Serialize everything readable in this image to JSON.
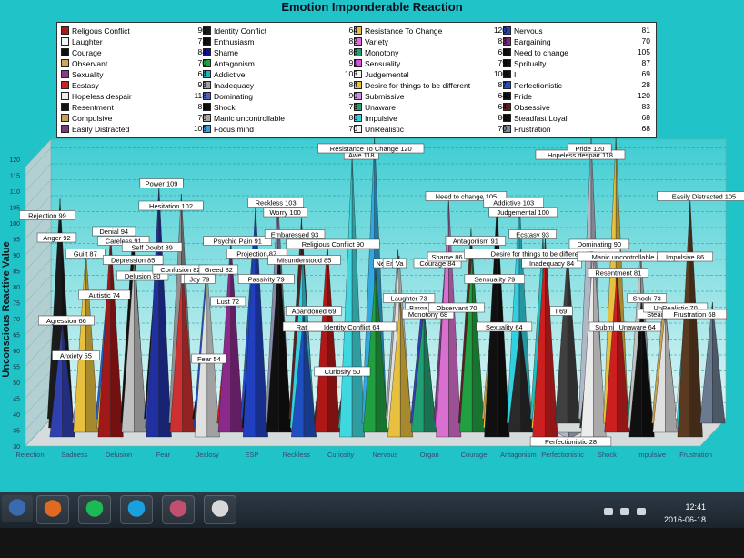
{
  "colors": {
    "screen": "#20c4c8",
    "plot_top": "#3ecdd2",
    "plot_bottom": "#e4f6f6",
    "floor": "#d6dcdc"
  },
  "chart_data": {
    "type": "area",
    "title": "Emotion Imponderable Reaction",
    "ylabel": "Unconscious Reactive Value",
    "ylim": [
      30,
      120
    ],
    "yticks": [
      30,
      35,
      40,
      45,
      50,
      55,
      60,
      65,
      70,
      75,
      80,
      85,
      90,
      95,
      100,
      105,
      110,
      115,
      120
    ],
    "grid": true,
    "x_tick_labels": [
      "Rejection",
      "Sadness",
      "Delusion",
      "Fear",
      "Jealosy",
      "ESP",
      "Reckless",
      "Curiosity",
      "Nervous",
      "Organ",
      "Courage",
      "Antagonism",
      "Perfectionistic",
      "Shock",
      "Impulsive",
      "Frustration"
    ],
    "legend": [
      {
        "name": "Religous Conflict",
        "value": 90,
        "color": "#b01818"
      },
      {
        "name": "Laughter",
        "value": 73,
        "color": "#f4f4f4"
      },
      {
        "name": "Courage",
        "value": 84,
        "color": "#101010"
      },
      {
        "name": "Observant",
        "value": 70,
        "color": "#ccaa55"
      },
      {
        "name": "Sexuality",
        "value": 64,
        "color": "#8a3a8a"
      },
      {
        "name": "Ecstasy",
        "value": 93,
        "color": "#d02020"
      },
      {
        "name": "Hopeless despair",
        "value": 118,
        "color": "#ececec"
      },
      {
        "name": "Resentment",
        "value": 81,
        "color": "#141414"
      },
      {
        "name": "Compulsive",
        "value": 70,
        "color": "#c8a050"
      },
      {
        "name": "Easily Distracted",
        "value": 105,
        "color": "#7a3a7a"
      },
      {
        "name": "Identity Conflict",
        "value": 64,
        "color": "#1a1a1a"
      },
      {
        "name": "Enthusiasm",
        "value": 82,
        "color": "#101010"
      },
      {
        "name": "Shame",
        "value": 86,
        "color": "#1010a0"
      },
      {
        "name": "Antagonism",
        "value": 91,
        "color": "#20a040"
      },
      {
        "name": "Addictive",
        "value": 103,
        "color": "#20b0c0"
      },
      {
        "name": "Inadequacy",
        "value": 84,
        "color": "#a0a0a0"
      },
      {
        "name": "Dominating",
        "value": 90,
        "color": "#5060c0"
      },
      {
        "name": "Shock",
        "value": 73,
        "color": "#101010"
      },
      {
        "name": "Manic uncontrollable",
        "value": 86,
        "color": "#a8a8a8"
      },
      {
        "name": "Focus mind",
        "value": 70,
        "color": "#30a0e0"
      },
      {
        "name": "Resistance To Change",
        "value": 120,
        "color": "#e8c040"
      },
      {
        "name": "Variety",
        "value": 83,
        "color": "#d870d0"
      },
      {
        "name": "Monotony",
        "value": 68,
        "color": "#20a070"
      },
      {
        "name": "Sensuality",
        "value": 79,
        "color": "#e050e0"
      },
      {
        "name": "Judgemental",
        "value": 100,
        "color": "#f4f4f4"
      },
      {
        "name": "Desire for things to be different",
        "value": 87,
        "color": "#e8c040"
      },
      {
        "name": "Submissive",
        "value": 64,
        "color": "#d090e0"
      },
      {
        "name": "Unaware",
        "value": 64,
        "color": "#20a070"
      },
      {
        "name": "Impulsive",
        "value": 86,
        "color": "#30d0e0"
      },
      {
        "name": "UnRealistic",
        "value": 70,
        "color": "#f4f4f4"
      },
      {
        "name": "Nervous",
        "value": 81,
        "color": "#2040c0"
      },
      {
        "name": "Bargaining",
        "value": 70,
        "color": "#7a2a7a"
      },
      {
        "name": "Need to change",
        "value": 105,
        "color": "#101010"
      },
      {
        "name": "Spritualty",
        "value": 87,
        "color": "#101010"
      },
      {
        "name": "I",
        "value": 69,
        "color": "#101010"
      },
      {
        "name": "Perfectionistic",
        "value": 28,
        "color": "#2050c0"
      },
      {
        "name": "Pride",
        "value": 120,
        "color": "#101010"
      },
      {
        "name": "Obsessive",
        "value": 83,
        "color": "#5a2020"
      },
      {
        "name": "Steadfast Loyal",
        "value": 68,
        "color": "#101010"
      },
      {
        "name": "Frustration",
        "value": 68,
        "color": "#7a8aa0"
      }
    ],
    "legend_column_values": [
      [
        90,
        73,
        84,
        70,
        64,
        93,
        118,
        81,
        70,
        105
      ],
      [
        64,
        82,
        86,
        91,
        103,
        84,
        90,
        73,
        86,
        70
      ],
      [
        120,
        83,
        68,
        79,
        100,
        87,
        64,
        64,
        86,
        70
      ],
      [
        81,
        70,
        105,
        87,
        69,
        28,
        120,
        83,
        68,
        68
      ]
    ],
    "series": [
      {
        "name": "Rejection",
        "value": 99,
        "color": "#1a1a1a"
      },
      {
        "name": "Anger",
        "value": 92,
        "color": "#1a1a1a"
      },
      {
        "name": "Agression",
        "value": 66,
        "color": "#3040b0"
      },
      {
        "name": "Anxiety",
        "value": 55,
        "color": "#b0b8c8"
      },
      {
        "name": "Guilt",
        "value": 87,
        "color": "#e8c040"
      },
      {
        "name": "Sadness",
        "value": 74,
        "color": "#2060d0"
      },
      {
        "name": "Autistic",
        "value": 74,
        "color": "#e8c040"
      },
      {
        "name": "Denial",
        "value": 94,
        "color": "#a01818"
      },
      {
        "name": "Careless",
        "value": 91,
        "color": "#101010"
      },
      {
        "name": "Depression",
        "value": 85,
        "color": "#c0c0c0"
      },
      {
        "name": "Delusion",
        "value": 80,
        "color": "#101010"
      },
      {
        "name": "Self Doubt",
        "value": 89,
        "color": "#3050c0"
      },
      {
        "name": "Power",
        "value": 109,
        "color": "#2030a0"
      },
      {
        "name": "Hesitation",
        "value": 102,
        "color": "#909090"
      },
      {
        "name": "Confusion",
        "value": 82,
        "color": "#cc3030"
      },
      {
        "name": "Fear",
        "value": 54,
        "color": "#101010"
      },
      {
        "name": "Jealosy",
        "value": 79,
        "color": "#2050c0"
      },
      {
        "name": "Greed",
        "value": 82,
        "color": "#e0e0e0"
      },
      {
        "name": "Lust",
        "value": 72,
        "color": "#cc2020"
      },
      {
        "name": "Psychic Pain",
        "value": 91,
        "color": "#8a2a8a"
      },
      {
        "name": "ESP",
        "value": 87,
        "color": "#2050c0"
      },
      {
        "name": "Passivity",
        "value": 79,
        "color": "#101010"
      },
      {
        "name": "Reckless",
        "value": 103,
        "color": "#2040c0"
      },
      {
        "name": "Worry",
        "value": 100,
        "color": "#8888aa"
      },
      {
        "name": "Projection",
        "value": 87,
        "color": "#101010"
      },
      {
        "name": "Embaressed",
        "value": 93,
        "color": "#5a2020"
      },
      {
        "name": "Misunderstood",
        "value": 85,
        "color": "#30d0e0"
      },
      {
        "name": "Abandoned",
        "value": 69,
        "color": "#2050c0"
      },
      {
        "name": "Rationalization",
        "value": 64,
        "color": "#5a2020"
      },
      {
        "name": "Religious Conflict",
        "value": 90,
        "color": "#b01818"
      },
      {
        "name": "Curiosity",
        "value": 50,
        "color": "#3a3a3a"
      },
      {
        "name": "Identity Conflict",
        "value": 64,
        "color": "#20c0d0"
      },
      {
        "name": "Awe",
        "value": 118,
        "color": "#40d8e0"
      },
      {
        "name": "Resistance To Change",
        "value": 120,
        "color": "#30a8e0"
      },
      {
        "name": "Nervous",
        "value": 81,
        "color": "#20a040"
      },
      {
        "name": "Envy",
        "value": 83,
        "color": "#a0a0a0"
      },
      {
        "name": "Vanity",
        "value": 84,
        "color": "#e0e0e0"
      },
      {
        "name": "Laughter",
        "value": 73,
        "color": "#e8c040"
      },
      {
        "name": "Bargaining",
        "value": 70,
        "color": "#3040b0"
      },
      {
        "name": "Monotony",
        "value": 68,
        "color": "#20a070"
      },
      {
        "name": "Courage",
        "value": 84,
        "color": "#7a3a7a"
      },
      {
        "name": "Shame",
        "value": 86,
        "color": "#e050e0"
      },
      {
        "name": "Need to change",
        "value": 105,
        "color": "#d870d0"
      },
      {
        "name": "Antagonism",
        "value": 91,
        "color": "#5a2020"
      },
      {
        "name": "Spiritualty",
        "value": 87,
        "color": "#20a040"
      },
      {
        "name": "Observant",
        "value": 70,
        "color": "#ccaa55"
      },
      {
        "name": "Sensuality",
        "value": 79,
        "color": "#f0c030"
      },
      {
        "name": "Addictive",
        "value": 103,
        "color": "#101010"
      },
      {
        "name": "Judgemental",
        "value": 100,
        "color": "#30d0e0"
      },
      {
        "name": "Sexuality",
        "value": 64,
        "color": "#2a2a2a"
      },
      {
        "name": "Desire for things to be different",
        "value": 87,
        "color": "#20c0c0"
      },
      {
        "name": "I",
        "value": 69,
        "color": "#e8c040"
      },
      {
        "name": "Ecstasy",
        "value": 93,
        "color": "#cc2020"
      },
      {
        "name": "Inadequacy",
        "value": 84,
        "color": "#404040"
      },
      {
        "name": "Perfectionistic",
        "value": 28,
        "color": "#b0b8c8"
      },
      {
        "name": "Hopeless despair",
        "value": 118,
        "color": "#b0b8c8"
      },
      {
        "name": "Submissive",
        "value": 64,
        "color": "#2a2a2a"
      },
      {
        "name": "Dominating",
        "value": 90,
        "color": "#ececec"
      },
      {
        "name": "Pride",
        "value": 120,
        "color": "#e8c040"
      },
      {
        "name": "Resentment",
        "value": 81,
        "color": "#cc2020"
      },
      {
        "name": "Unaware",
        "value": 64,
        "color": "#20a070"
      },
      {
        "name": "Manic uncontrollable",
        "value": 86,
        "color": "#c0c0c0"
      },
      {
        "name": "Shock",
        "value": 73,
        "color": "#101010"
      },
      {
        "name": "Compulsive",
        "value": 70,
        "color": "#c8a050"
      },
      {
        "name": "Steadfast",
        "value": 68,
        "color": "#e0e0e0"
      },
      {
        "name": "UnRealistic",
        "value": 70,
        "color": "#f4f4f4"
      },
      {
        "name": "Impulsive",
        "value": 86,
        "color": "#30d0e0"
      },
      {
        "name": "Easily Distracted",
        "value": 105,
        "color": "#5a3a20"
      },
      {
        "name": "Frustration",
        "value": 68,
        "color": "#6a7a90"
      }
    ],
    "data_labels": [
      {
        "text": "Rejection 99",
        "value": 99
      },
      {
        "text": "Anger 92",
        "value": 92
      },
      {
        "text": "Agression 66",
        "value": 66
      },
      {
        "text": "Anxiety 55",
        "value": 55
      },
      {
        "text": "Guilt 87",
        "value": 87
      },
      {
        "text": "Sadi",
        "value": 74
      },
      {
        "text": "Autistic 74",
        "value": 74
      },
      {
        "text": "Denial 94",
        "value": 94
      },
      {
        "text": "Careless 91",
        "value": 91
      },
      {
        "text": "Depression 85",
        "value": 85
      },
      {
        "text": "Delusion 80",
        "value": 80
      },
      {
        "text": "Self Doubt 89",
        "value": 89
      },
      {
        "text": "Power 109",
        "value": 109
      },
      {
        "text": "Hesitation 102",
        "value": 102
      },
      {
        "text": "Confusion 82",
        "value": 82
      },
      {
        "text": "Jea",
        "value": 79
      },
      {
        "text": "Joy 79",
        "value": 79
      },
      {
        "text": "Fear 54",
        "value": 54
      },
      {
        "text": "Greed 82",
        "value": 82
      },
      {
        "text": "Lust 72",
        "value": 72
      },
      {
        "text": "Psychic Pain 91",
        "value": 91
      },
      {
        "text": "ESP",
        "value": 87
      },
      {
        "text": "Projection 87",
        "value": 87
      },
      {
        "text": "Passivity 79",
        "value": 79
      },
      {
        "text": "Reckless 103",
        "value": 103
      },
      {
        "text": "Worry 100",
        "value": 100
      },
      {
        "text": "Embaressed 93",
        "value": 93
      },
      {
        "text": "Misunderstood 85",
        "value": 85
      },
      {
        "text": "Abandoned 69",
        "value": 69
      },
      {
        "text": "Rationalization 64",
        "value": 64
      },
      {
        "text": "Religious Conflict 90",
        "value": 90
      },
      {
        "text": "Curiosity 50",
        "value": 50
      },
      {
        "text": "Identity Conflict 64",
        "value": 64
      },
      {
        "text": "Awe 118",
        "value": 118
      },
      {
        "text": "Resistance To Change 120",
        "value": 120
      },
      {
        "text": "Ne",
        "value": 84
      },
      {
        "text": "En",
        "value": 84
      },
      {
        "text": "Va",
        "value": 84
      },
      {
        "text": "Laughter 73",
        "value": 73
      },
      {
        "text": "Barga",
        "value": 70
      },
      {
        "text": "Monotony 68",
        "value": 68
      },
      {
        "text": "Courage 84",
        "value": 84
      },
      {
        "text": "Shame 86",
        "value": 86
      },
      {
        "text": "Observant 70",
        "value": 70
      },
      {
        "text": "Need to change 105",
        "value": 105
      },
      {
        "text": "Antagonism 91",
        "value": 91
      },
      {
        "text": "Spirit",
        "value": 87
      },
      {
        "text": "Sensuality 79",
        "value": 79
      },
      {
        "text": "Sexuality 64",
        "value": 64
      },
      {
        "text": "Addictive 103",
        "value": 103
      },
      {
        "text": "Judgemental 100",
        "value": 100
      },
      {
        "text": "Ecstasy 93",
        "value": 93
      },
      {
        "text": "Desire for things to be different 87",
        "value": 87
      },
      {
        "text": "Inadequacy 84",
        "value": 84
      },
      {
        "text": "I 69",
        "value": 69
      },
      {
        "text": "Perfectionistic 28",
        "value": 28
      },
      {
        "text": "Hopeless despair 118",
        "value": 118
      },
      {
        "text": "Pride 120",
        "value": 120
      },
      {
        "text": "Dominating 90",
        "value": 90
      },
      {
        "text": "Submissi",
        "value": 64
      },
      {
        "text": "Resentment 81",
        "value": 81
      },
      {
        "text": "Manic uncontrollable 86",
        "value": 86
      },
      {
        "text": "Unaware 64",
        "value": 64
      },
      {
        "text": "Shock 73",
        "value": 73
      },
      {
        "text": "Com",
        "value": 70
      },
      {
        "text": "Steadfast 68",
        "value": 68
      },
      {
        "text": "UnRealistic 70",
        "value": 70
      },
      {
        "text": "Impulsive 86",
        "value": 86
      },
      {
        "text": "Frustration 68",
        "value": 68
      },
      {
        "text": "Easily Distracted 105",
        "value": 105
      }
    ]
  },
  "taskbar": {
    "time": "12:41",
    "date": "2016-06-18",
    "apps": [
      {
        "name": "start-orb",
        "color": "#3a6ab0"
      },
      {
        "name": "firefox",
        "color": "#e06a20"
      },
      {
        "name": "spotify",
        "color": "#1db954"
      },
      {
        "name": "skype",
        "color": "#1aa0e0"
      },
      {
        "name": "tool",
        "color": "#c05070"
      },
      {
        "name": "document",
        "color": "#d8d8d8"
      }
    ],
    "tray": [
      "show-hidden-icons",
      "network-icon",
      "volume-icon"
    ]
  }
}
